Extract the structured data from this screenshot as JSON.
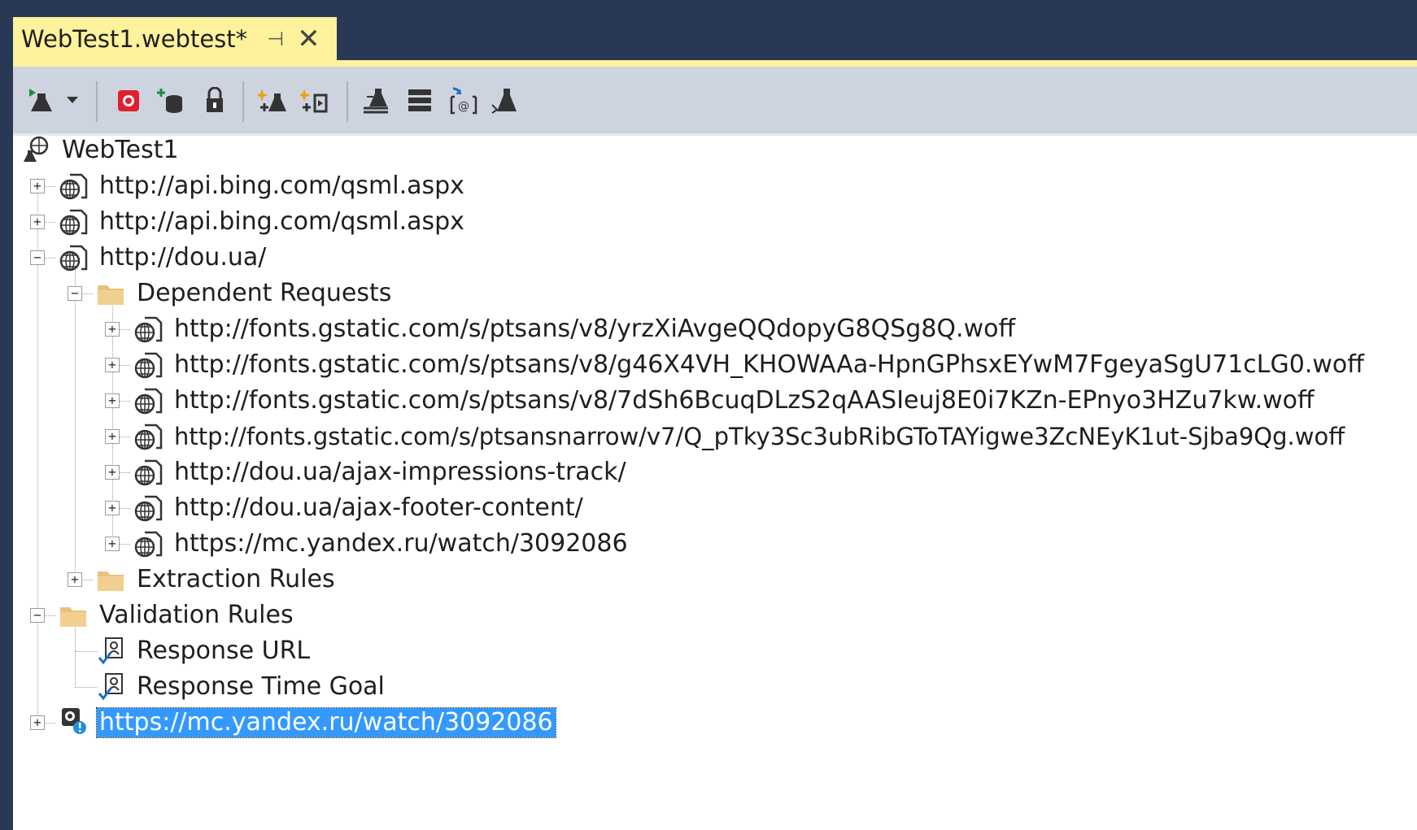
{
  "tab": {
    "title": "WebTest1.webtest*",
    "pin_glyph": "⊣",
    "close_glyph": "✕"
  },
  "toolbar": {
    "buttons": [
      "run-test-icon",
      "dropdown-arrow-icon",
      "record-icon",
      "add-datasource-icon",
      "lock-icon",
      "add-request-icon",
      "insert-request-icon",
      "extract-icon",
      "list-icon",
      "parameterize-icon",
      "flask-icon"
    ]
  },
  "tree": {
    "root": "WebTest1",
    "requests": [
      {
        "url": "http://api.bing.com/qsml.aspx"
      },
      {
        "url": "http://api.bing.com/qsml.aspx"
      },
      {
        "url": "http://dou.ua/"
      }
    ],
    "dependent_requests_label": "Dependent Requests",
    "dependent": [
      "http://fonts.gstatic.com/s/ptsans/v8/yrzXiAvgeQQdopyG8QSg8Q.woff",
      "http://fonts.gstatic.com/s/ptsans/v8/g46X4VH_KHOWAAa-HpnGPhsxEYwM7FgeyaSgU71cLG0.woff",
      "http://fonts.gstatic.com/s/ptsans/v8/7dSh6BcuqDLzS2qAASIeuj8E0i7KZn-EPnyo3HZu7kw.woff",
      "http://fonts.gstatic.com/s/ptsansnarrow/v7/Q_pTky3Sc3ubRibGToTAYigwe3ZcNEyK1ut-Sjba9Qg.woff",
      "http://dou.ua/ajax-impressions-track/",
      "http://dou.ua/ajax-footer-content/",
      "https://mc.yandex.ru/watch/3092086"
    ],
    "extraction_rules_label": "Extraction Rules",
    "validation_rules_label": "Validation Rules",
    "validation_rules": [
      "Response URL",
      "Response Time Goal"
    ],
    "last_request": "https://mc.yandex.ru/watch/3092086"
  },
  "colors": {
    "tab_active": "#fff29d",
    "chrome": "#293955",
    "selection": "#3399ff"
  }
}
